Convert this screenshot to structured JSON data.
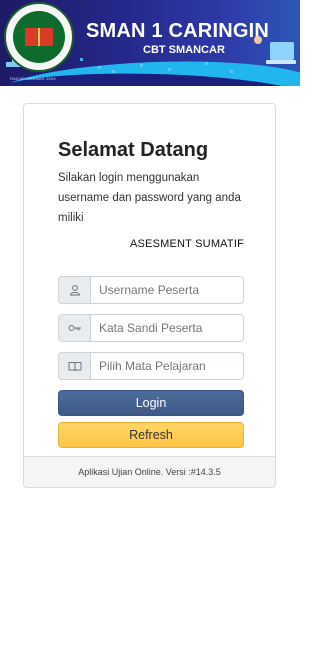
{
  "header": {
    "school_name": "SMAN 1 CARINGIN",
    "subtitle": "CBT SMANCAR",
    "logo_caption": "RAKOP SMEMAS 2024"
  },
  "login": {
    "title": "Selamat Datang",
    "description": "Silakan login menggunakan username dan password yang anda miliki",
    "marquee_text": "ASESMENT SUMATIF",
    "username_placeholder": "Username Peserta",
    "password_placeholder": "Kata Sandi Peserta",
    "subject_placeholder": "Pilih Mata Pelajaran",
    "login_label": "Login",
    "refresh_label": "Refresh",
    "footer": "Aplikasi Ujian Online. Versi :#14.3.5"
  },
  "icons": {
    "username": "user-icon",
    "password": "key-icon",
    "subject": "book-icon"
  },
  "colors": {
    "banner": "#262a8e",
    "login_button": "#4a6594",
    "refresh_button": "#ffcc4f"
  }
}
